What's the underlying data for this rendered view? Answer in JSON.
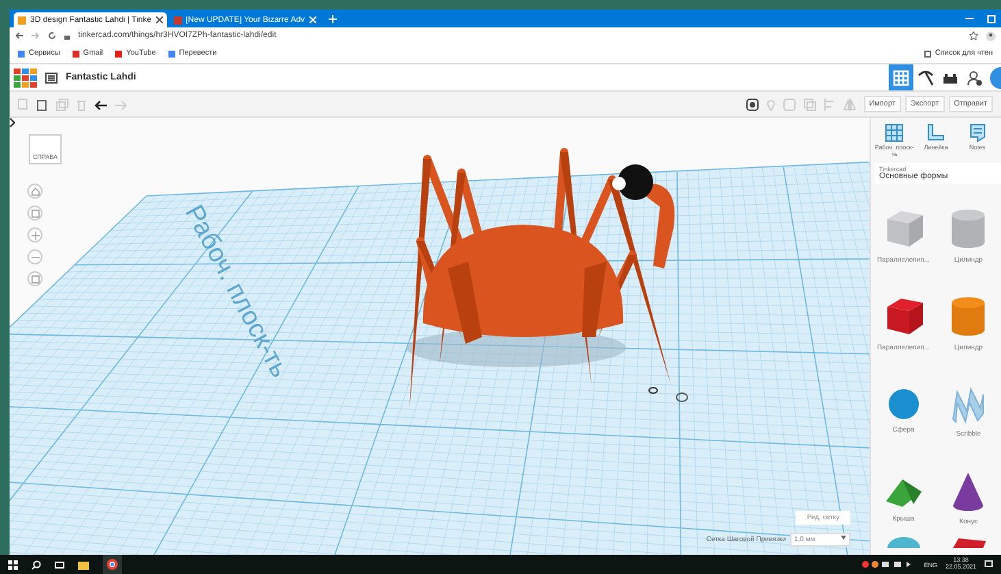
{
  "browser": {
    "tabs": [
      {
        "title": "3D design Fantastic Lahdi | Tinke",
        "selected": true
      },
      {
        "title": "[New UPDATE] Your Bizarre Adv",
        "selected": false
      }
    ],
    "url": "tinkercad.com/things/hr3HVOI7ZPh-fantastic-lahdi/edit",
    "bookmarks": [
      "Сервисы",
      "Gmail",
      "YouTube",
      "Перевести"
    ],
    "reading_list": "Список для чтен"
  },
  "app": {
    "title": "Fantastic Lahdi",
    "modes": [
      {
        "kind": "grid",
        "selected": true
      },
      {
        "kind": "pickaxe",
        "selected": false
      },
      {
        "kind": "bricks",
        "selected": false
      }
    ],
    "actions": [
      "Импорт",
      "Экспорт",
      "Отправит"
    ]
  },
  "canvas": {
    "view_cube": "СПРАВА",
    "workplane_label": "Рабоч. плоск-ть",
    "edit_grid": "Ред. сетку",
    "snap_label": "Сетка Шаговой Привязки",
    "snap_value": "1,0 мм"
  },
  "panel": {
    "tools": [
      {
        "kind": "workplane",
        "label": "Рабоч. плоск-ть"
      },
      {
        "kind": "ruler",
        "label": "Линейка"
      },
      {
        "kind": "notes",
        "label": "Notes"
      }
    ],
    "library": {
      "label": "Tinkercad",
      "value": "Основные формы"
    },
    "shapes": [
      {
        "kind": "box-hole",
        "label": "Параллелепип..."
      },
      {
        "kind": "cylinder-hole",
        "label": "Цилиндр"
      },
      {
        "kind": "box",
        "label": "Параллелепип..."
      },
      {
        "kind": "cylinder",
        "label": "Цилиндр"
      },
      {
        "kind": "sphere",
        "label": "Сфера"
      },
      {
        "kind": "scribble",
        "label": "Scribble"
      },
      {
        "kind": "roof",
        "label": "Крыша"
      },
      {
        "kind": "cone",
        "label": "Конус"
      }
    ]
  },
  "taskbar": {
    "language": "ENG",
    "time": "13:38",
    "date": "22.05.2021"
  }
}
